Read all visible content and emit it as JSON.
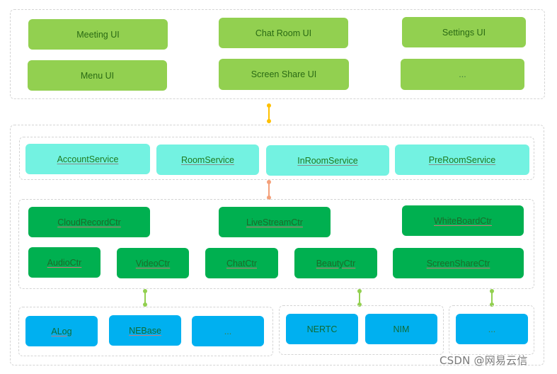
{
  "ui_layer": {
    "items": [
      "Meeting UI",
      "Chat Room UI",
      "Settings UI",
      "Menu UI",
      "Screen Share UI",
      "..."
    ]
  },
  "service_layer": {
    "items": [
      "AccountService",
      "RoomService",
      "InRoomService",
      "PreRoomService"
    ]
  },
  "controller_layer": {
    "row1": [
      "CloudRecordCtr",
      "LiveStreamCtr",
      "WhiteBoardCtr"
    ],
    "row2": [
      "AudioCtr",
      "VideoCtr",
      "ChatCtr",
      "BeautyCtr",
      "ScreenShareCtr"
    ]
  },
  "library_layer": {
    "group1": [
      "ALog",
      "NEBase",
      "..."
    ],
    "group2": [
      "NERTC",
      "NIM"
    ],
    "group3": [
      "..."
    ]
  },
  "colors": {
    "ui": "#92d050",
    "service": "#73f2e1",
    "controller": "#00b050",
    "library": "#00b0f0",
    "arrow_ui_core": "#ffc000",
    "arrow_service_ctr": "#f4a07a",
    "arrow_ctr_lib": "#92d050"
  },
  "watermark": "CSDN @网易云信"
}
